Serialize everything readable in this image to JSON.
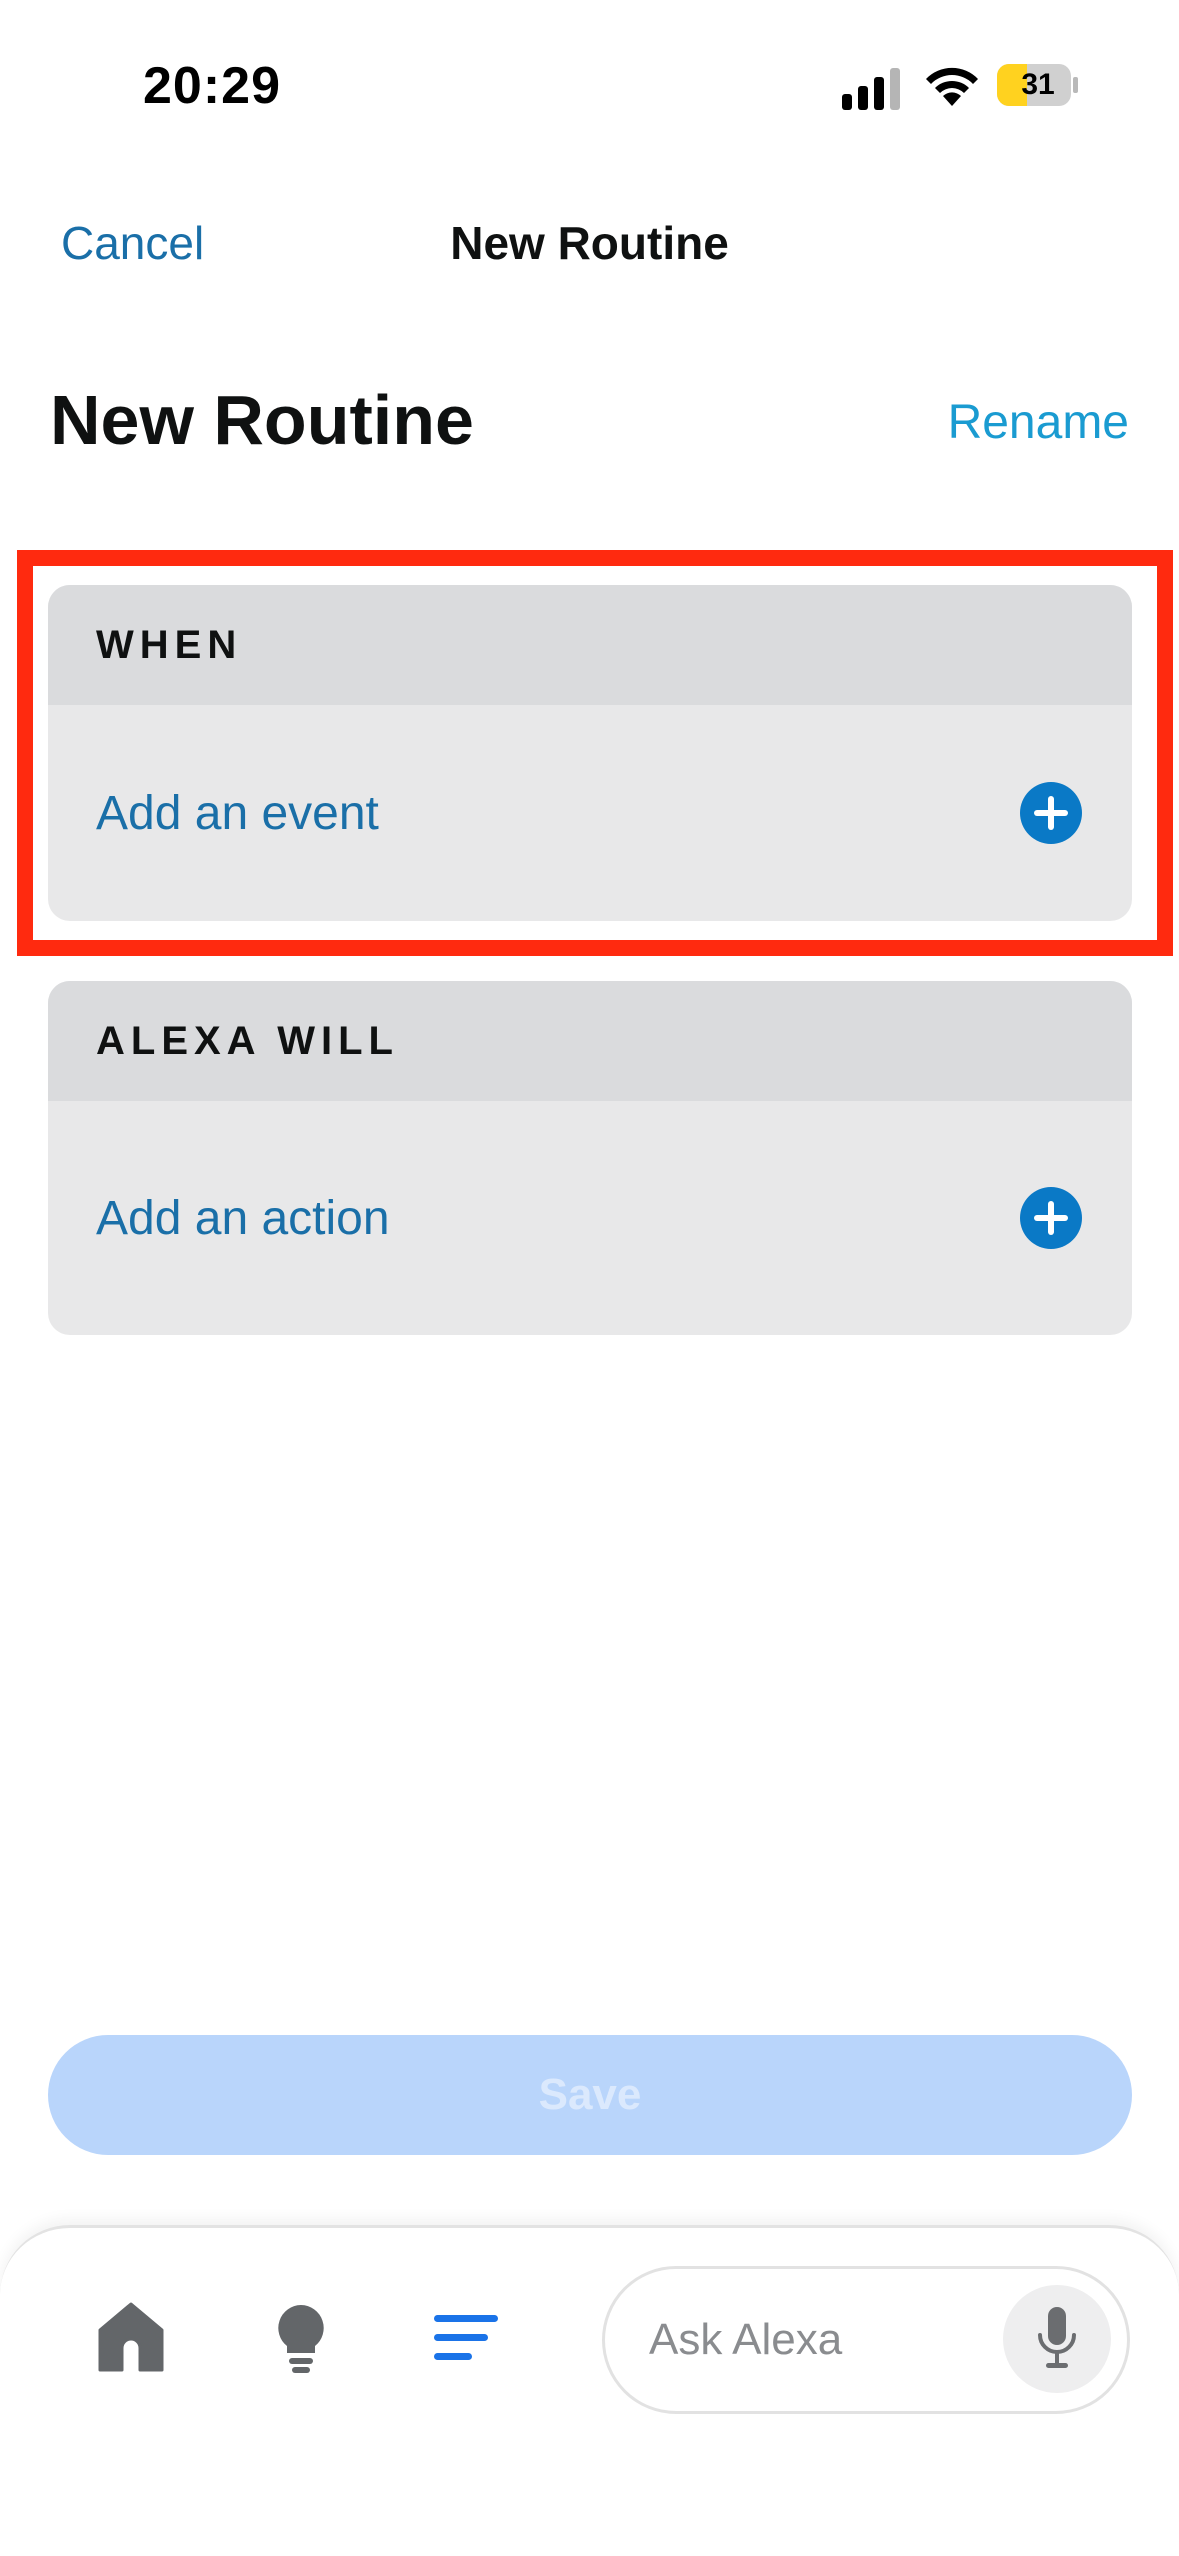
{
  "status_bar": {
    "time": "20:29",
    "battery_level": "31",
    "battery_color": "#ffd21f"
  },
  "nav": {
    "cancel_label": "Cancel",
    "title": "New Routine"
  },
  "header": {
    "title": "New Routine",
    "rename_label": "Rename"
  },
  "sections": {
    "when": {
      "header": "WHEN",
      "row_label": "Add an event",
      "highlighted": true
    },
    "alexa_will": {
      "header": "ALEXA WILL",
      "row_label": "Add an action"
    }
  },
  "save_button": {
    "label": "Save",
    "enabled": false
  },
  "bottom_bar": {
    "tabs": [
      {
        "icon": "home-icon",
        "active": false
      },
      {
        "icon": "lightbulb-icon",
        "active": false
      },
      {
        "icon": "menu-icon",
        "active": true
      }
    ],
    "ask_placeholder": "Ask Alexa",
    "mic_icon": "microphone-icon"
  },
  "colors": {
    "link": "#1a6fa8",
    "rename": "#1a9bd1",
    "add_button": "#0a79c6",
    "highlight": "#ff2a0f",
    "save_disabled": "#b9d5fb",
    "active_tab": "#1a73e8"
  }
}
